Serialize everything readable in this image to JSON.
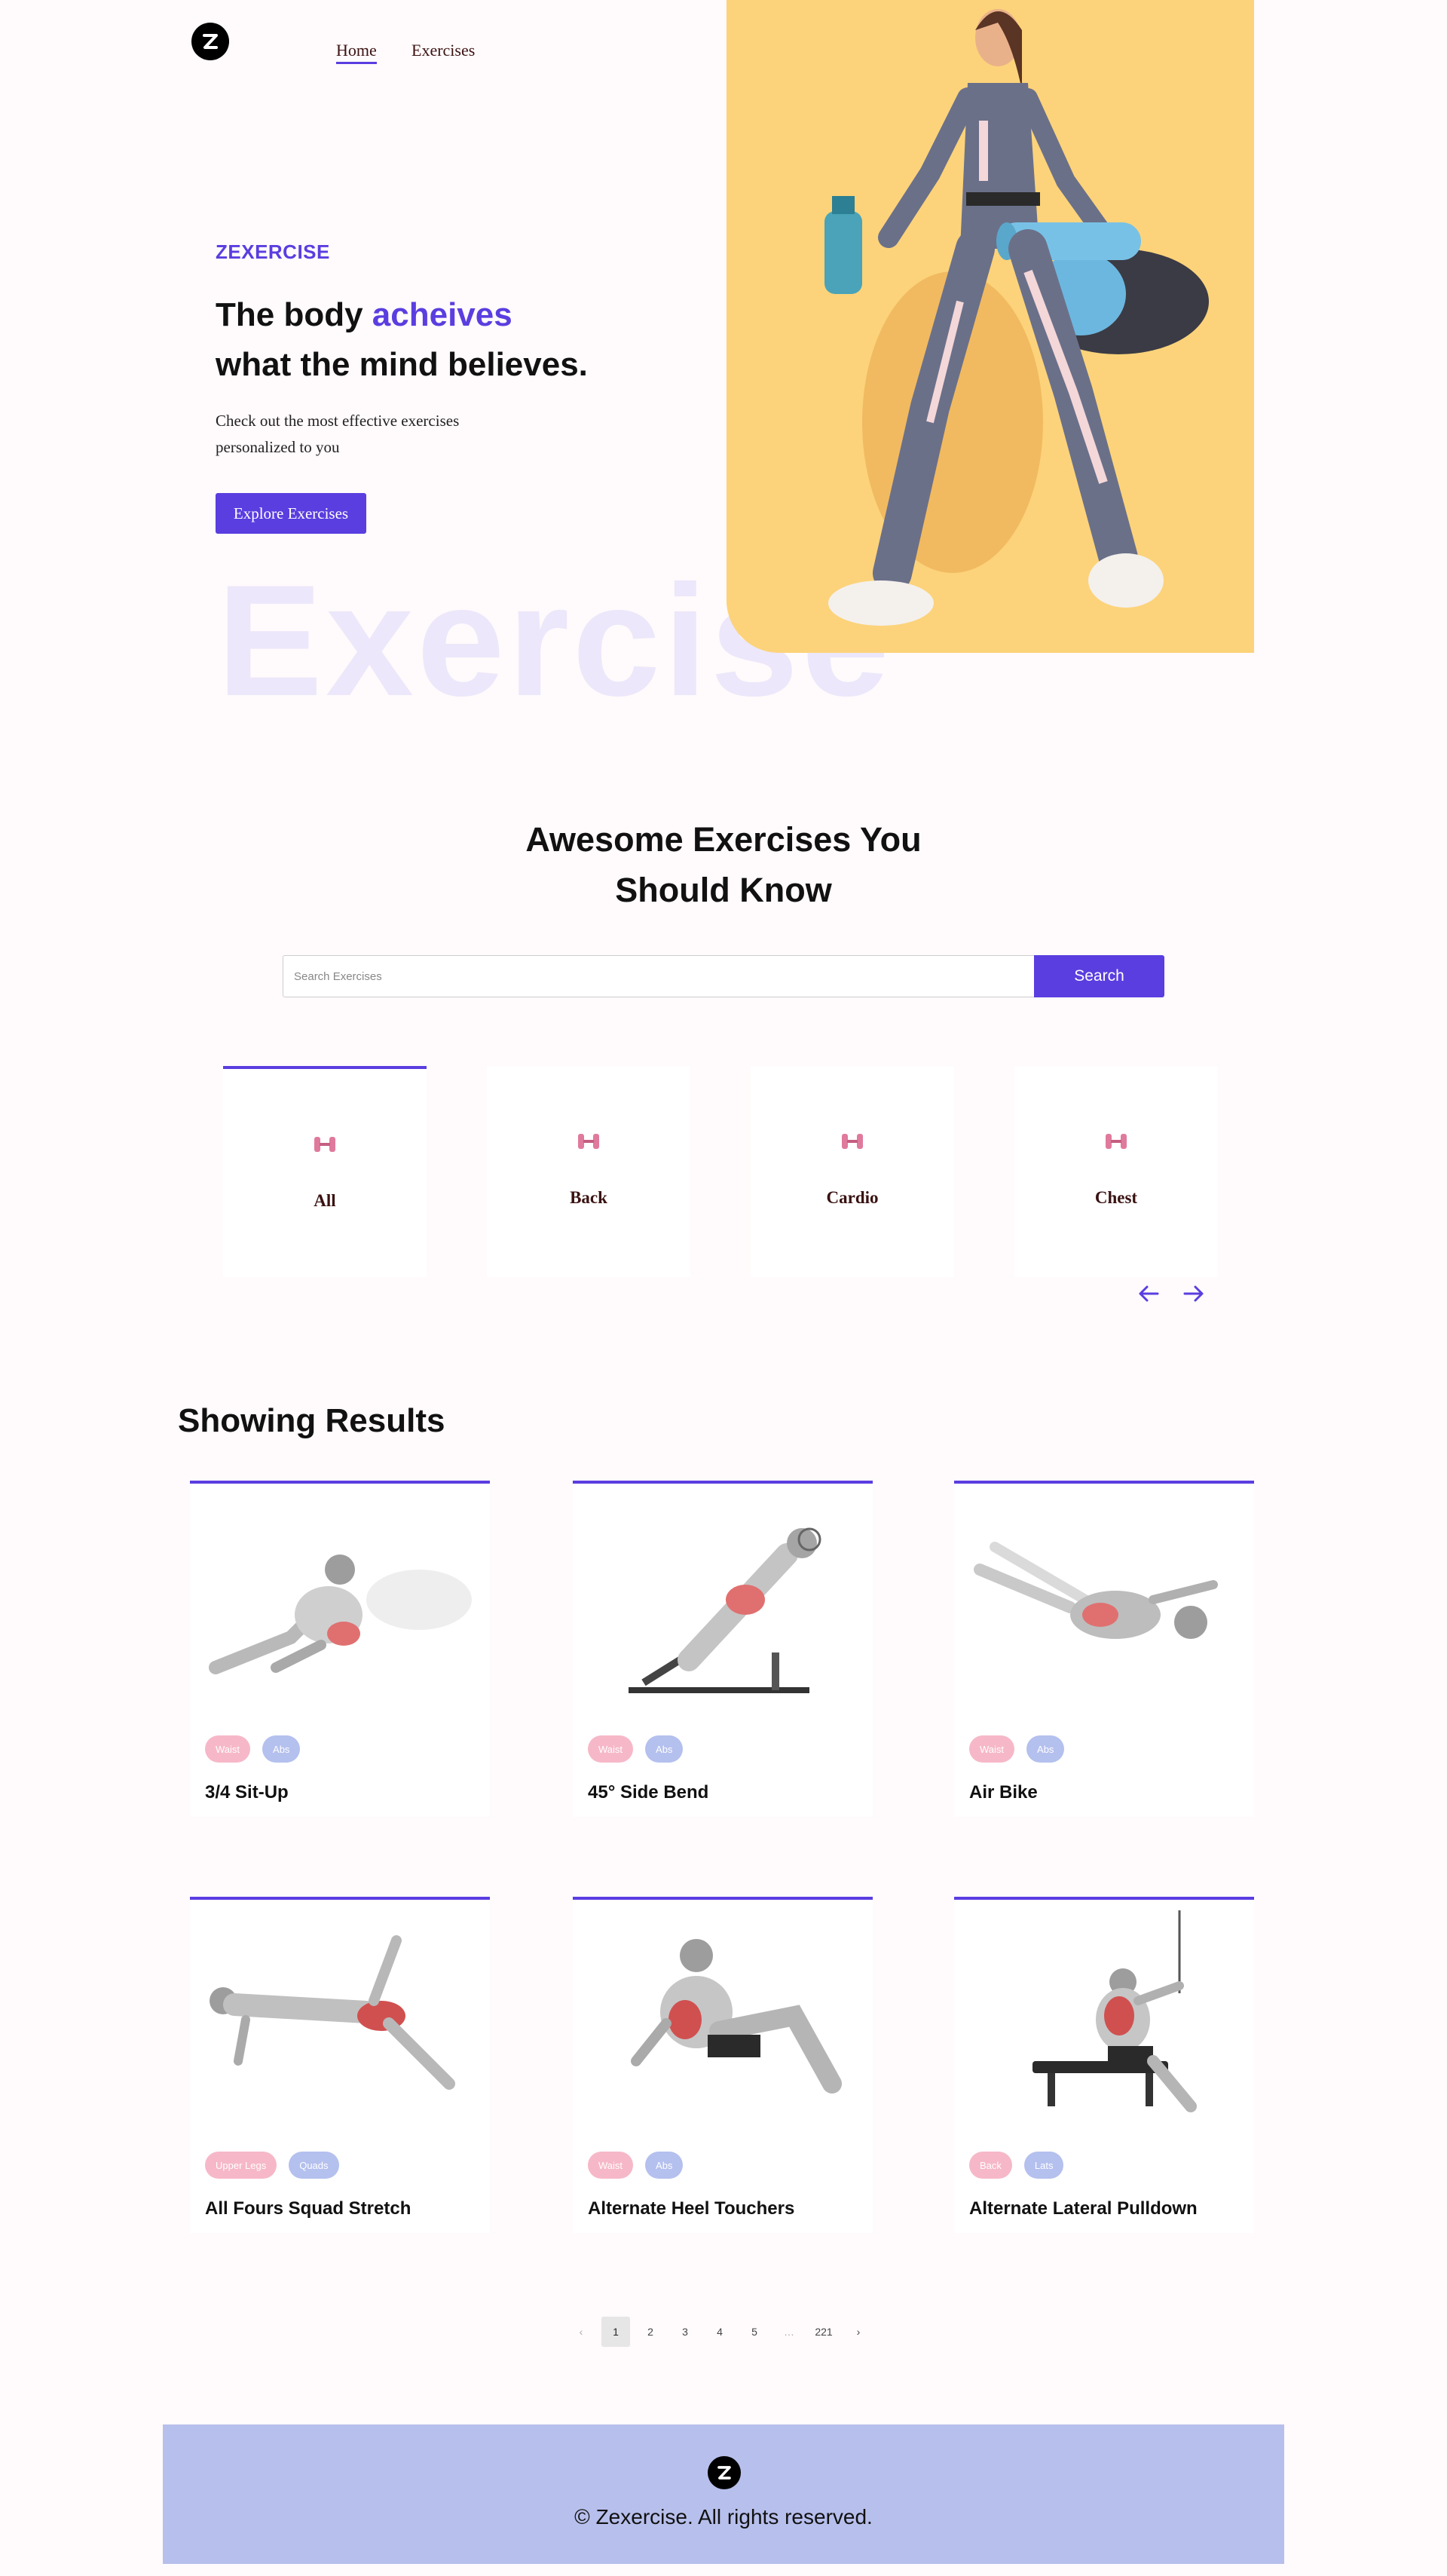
{
  "nav": {
    "home": "Home",
    "exercises": "Exercises"
  },
  "hero": {
    "eyebrow": "ZEXERCISE",
    "title_part1": "The body ",
    "title_accent": "acheives",
    "title_line2": "what the mind believes.",
    "subtitle": "Check out the most effective exercises personalized to you",
    "cta": "Explore Exercises",
    "bg_word": "Exercise"
  },
  "search": {
    "title_line1": "Awesome Exercises You",
    "title_line2": "Should Know",
    "placeholder": "Search Exercises",
    "button": "Search"
  },
  "categories": [
    {
      "label": "All",
      "active": true
    },
    {
      "label": "Back",
      "active": false
    },
    {
      "label": "Cardio",
      "active": false
    },
    {
      "label": "Chest",
      "active": false
    }
  ],
  "results": {
    "title": "Showing Results",
    "exercises": [
      {
        "name": "3/4 Sit-Up",
        "tags": [
          "Waist",
          "Abs"
        ]
      },
      {
        "name": "45° Side Bend",
        "tags": [
          "Waist",
          "Abs"
        ]
      },
      {
        "name": "Air Bike",
        "tags": [
          "Waist",
          "Abs"
        ]
      },
      {
        "name": "All Fours Squad Stretch",
        "tags": [
          "Upper Legs",
          "Quads"
        ]
      },
      {
        "name": "Alternate Heel Touchers",
        "tags": [
          "Waist",
          "Abs"
        ]
      },
      {
        "name": "Alternate Lateral Pulldown",
        "tags": [
          "Back",
          "Lats"
        ]
      }
    ]
  },
  "pagination": {
    "prev": "‹",
    "pages": [
      "1",
      "2",
      "3",
      "4",
      "5",
      "…",
      "221"
    ],
    "current": "1",
    "next": "›"
  },
  "footer": {
    "copyright": "© Zexercise. All rights reserved."
  },
  "colors": {
    "accent": "#5a3ee0",
    "tag_pink": "#f6b8c8",
    "tag_blue": "#b4c0ee",
    "footer_bg": "#b7bfec",
    "hero_bg": "#fcd37a"
  }
}
